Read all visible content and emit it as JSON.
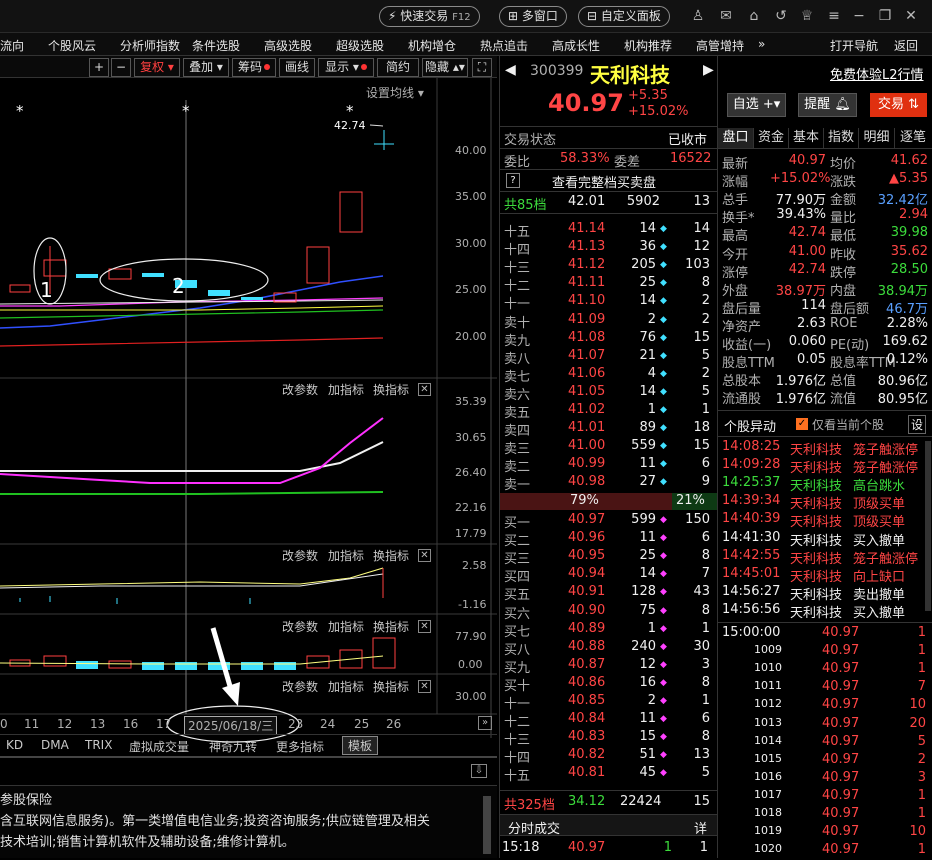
{
  "topbar": {
    "quick_trade": "快速交易",
    "quick_trade_key": "F12",
    "multi_window": "多窗口",
    "custom_panel": "自定义面板"
  },
  "menu": [
    "流向",
    "个股风云",
    "分析师指数",
    "条件选股",
    "高级选股",
    "超级选股",
    "机构增仓",
    "热点追击",
    "高成长性",
    "机构推荐",
    "高管增持",
    "»",
    "打开导航",
    "返回"
  ],
  "chart_toolbar": {
    "plus": "+",
    "minus": "−",
    "fuquan": "复权",
    "overlay": "叠加",
    "chips": "筹码",
    "draw": "画线",
    "display": "显示",
    "brief": "简约",
    "hide": "隐藏",
    "settings_ma": "设置均线"
  },
  "kline": {
    "price_ticks": [
      "40.00",
      "35.00",
      "30.00",
      "25.00",
      "20.00"
    ],
    "high_label": "42.74",
    "annotation_1": "1",
    "annotation_2": "2",
    "star": "*"
  },
  "indicator_panels": [
    {
      "change": "改参数",
      "add": "加指标",
      "swap": "换指标",
      "ticks": [
        "35.39",
        "30.65",
        "26.40",
        "22.16",
        "17.79"
      ]
    },
    {
      "change": "改参数",
      "add": "加指标",
      "swap": "换指标",
      "ticks": [
        "2.58",
        "-1.16"
      ]
    },
    {
      "change": "改参数",
      "add": "加指标",
      "swap": "换指标",
      "ticks": [
        "77.90",
        "0.00"
      ]
    },
    {
      "change": "改参数",
      "add": "加指标",
      "swap": "换指标",
      "ticks": [
        "30.00"
      ]
    }
  ],
  "date_axis": [
    "0",
    "11",
    "12",
    "13",
    "16",
    "17",
    "2025/06/18/三",
    "23",
    "24",
    "25",
    "26"
  ],
  "indicator_tabs": [
    "KD",
    "DMA",
    "TRIX",
    "虚拟成交量",
    "神奇九转",
    "更多指标",
    "模板"
  ],
  "company_text": {
    "line1": "参股保险",
    "line2": "含互联网信息服务)。第一类增值电信业务;投资咨询服务;供应链管理及相关",
    "line3": "技术培训;销售计算机软件及辅助设备;维修计算机。"
  },
  "stock": {
    "code": "300399",
    "name": "天利科技",
    "price": "40.97",
    "change": "+5.35",
    "change_pct": "+15.02%",
    "free_l2": "免费体验L2行情",
    "btn_watch": "自选",
    "btn_alert": "提醒",
    "btn_trade": "交易"
  },
  "orderbook": {
    "status_label": "交易状态",
    "status_value": "已收市",
    "weibi_label": "委比",
    "weibi_value": "58.33%",
    "weicha_label": "委差",
    "weicha_value": "16522",
    "full_book": "查看完整档买卖盘",
    "sell_total_label": "共85档",
    "sell_total_price": "42.01",
    "sell_total_vol": "5902",
    "sell_total_cnt": "13",
    "sells": [
      {
        "l": "十五",
        "p": "41.14",
        "v": "14",
        "c": "14"
      },
      {
        "l": "十四",
        "p": "41.13",
        "v": "36",
        "c": "12"
      },
      {
        "l": "十三",
        "p": "41.12",
        "v": "205",
        "c": "103"
      },
      {
        "l": "十二",
        "p": "41.11",
        "v": "25",
        "c": "8"
      },
      {
        "l": "十一",
        "p": "41.10",
        "v": "14",
        "c": "2"
      },
      {
        "l": "卖十",
        "p": "41.09",
        "v": "2",
        "c": "2"
      },
      {
        "l": "卖九",
        "p": "41.08",
        "v": "76",
        "c": "15"
      },
      {
        "l": "卖八",
        "p": "41.07",
        "v": "21",
        "c": "5"
      },
      {
        "l": "卖七",
        "p": "41.06",
        "v": "4",
        "c": "2"
      },
      {
        "l": "卖六",
        "p": "41.05",
        "v": "14",
        "c": "5"
      },
      {
        "l": "卖五",
        "p": "41.02",
        "v": "1",
        "c": "1"
      },
      {
        "l": "卖四",
        "p": "41.01",
        "v": "89",
        "c": "18"
      },
      {
        "l": "卖三",
        "p": "41.00",
        "v": "559",
        "c": "15"
      },
      {
        "l": "卖二",
        "p": "40.99",
        "v": "11",
        "c": "6"
      },
      {
        "l": "卖一",
        "p": "40.98",
        "v": "27",
        "c": "9"
      }
    ],
    "ratio_left": "79%",
    "ratio_right": "21%",
    "ratio_fraction": 0.79,
    "buys": [
      {
        "l": "买一",
        "p": "40.97",
        "v": "599",
        "c": "150"
      },
      {
        "l": "买二",
        "p": "40.96",
        "v": "11",
        "c": "6"
      },
      {
        "l": "买三",
        "p": "40.95",
        "v": "25",
        "c": "8"
      },
      {
        "l": "买四",
        "p": "40.94",
        "v": "14",
        "c": "7"
      },
      {
        "l": "买五",
        "p": "40.91",
        "v": "128",
        "c": "43"
      },
      {
        "l": "买六",
        "p": "40.90",
        "v": "75",
        "c": "8"
      },
      {
        "l": "买七",
        "p": "40.89",
        "v": "1",
        "c": "1"
      },
      {
        "l": "买八",
        "p": "40.88",
        "v": "240",
        "c": "30"
      },
      {
        "l": "买九",
        "p": "40.87",
        "v": "12",
        "c": "3"
      },
      {
        "l": "买十",
        "p": "40.86",
        "v": "16",
        "c": "8"
      },
      {
        "l": "十一",
        "p": "40.85",
        "v": "2",
        "c": "1"
      },
      {
        "l": "十二",
        "p": "40.84",
        "v": "11",
        "c": "6"
      },
      {
        "l": "十三",
        "p": "40.83",
        "v": "15",
        "c": "8"
      },
      {
        "l": "十四",
        "p": "40.82",
        "v": "51",
        "c": "13"
      },
      {
        "l": "十五",
        "p": "40.81",
        "v": "45",
        "c": "5"
      }
    ],
    "buy_total_label": "共325档",
    "buy_total_price": "34.12",
    "buy_total_vol": "22424",
    "buy_total_cnt": "15",
    "ticks_label": "分时成交",
    "ticks_detail": "详",
    "last_tick_time": "15:18",
    "last_tick_price": "40.97",
    "last_tick_vol": "1",
    "last_tick_cnt": "1"
  },
  "quote_tabs": [
    "盘口",
    "资金",
    "基本",
    "指数",
    "明细",
    "逐笔"
  ],
  "quote": [
    {
      "a": "最新",
      "av": "40.97",
      "b": "均价",
      "bv": "41.62"
    },
    {
      "a": "涨幅",
      "av": "+15.02%",
      "b": "涨跌",
      "bv": "▲5.35"
    },
    {
      "a": "总手",
      "av": "77.90万",
      "b": "金额",
      "bv": "32.42亿"
    },
    {
      "a": "换手*",
      "av": "39.43%",
      "b": "量比",
      "bv": "2.94"
    },
    {
      "a": "最高",
      "av": "42.74",
      "b": "最低",
      "bv": "39.98"
    },
    {
      "a": "今开",
      "av": "41.00",
      "b": "昨收",
      "bv": "35.62"
    },
    {
      "a": "涨停",
      "av": "42.74",
      "b": "跌停",
      "bv": "28.50"
    },
    {
      "a": "外盘",
      "av": "38.97万",
      "b": "内盘",
      "bv": "38.94万"
    },
    {
      "a": "盘后量",
      "av": "114",
      "b": "盘后额",
      "bv": "46.7万"
    },
    {
      "a": "净资产",
      "av": "2.63",
      "b": "ROE",
      "bv": "2.28%"
    },
    {
      "a": "收益(一)",
      "av": "0.060",
      "b": "PE(动)",
      "bv": "169.62"
    },
    {
      "a": "股息TTM",
      "av": "0.05",
      "b": "股息率TTM",
      "bv": "0.12%"
    },
    {
      "a": "总股本",
      "av": "1.976亿",
      "b": "总值",
      "bv": "80.96亿"
    },
    {
      "a": "流通股",
      "av": "1.976亿",
      "b": "流值",
      "bv": "80.95亿"
    }
  ],
  "movement": {
    "title": "个股异动",
    "only_current": "仅看当前个股",
    "settings": "设",
    "items": [
      {
        "t": "14:08:25",
        "n": "天利科技",
        "e": "笼子触涨停",
        "c": "red"
      },
      {
        "t": "14:09:28",
        "n": "天利科技",
        "e": "笼子触涨停",
        "c": "red"
      },
      {
        "t": "14:25:37",
        "n": "天利科技",
        "e": "高台跳水",
        "c": "green"
      },
      {
        "t": "14:39:34",
        "n": "天利科技",
        "e": "顶级买单",
        "c": "red"
      },
      {
        "t": "14:40:39",
        "n": "天利科技",
        "e": "顶级买单",
        "c": "red"
      },
      {
        "t": "14:41:30",
        "n": "天利科技",
        "e": "买入撤单",
        "c": "white"
      },
      {
        "t": "14:42:55",
        "n": "天利科技",
        "e": "笼子触涨停",
        "c": "red"
      },
      {
        "t": "14:45:01",
        "n": "天利科技",
        "e": "向上缺口",
        "c": "red"
      },
      {
        "t": "14:56:27",
        "n": "天利科技",
        "e": "卖出撤单",
        "c": "white"
      },
      {
        "t": "14:56:56",
        "n": "天利科技",
        "e": "买入撤单",
        "c": "white"
      }
    ]
  },
  "trades": [
    {
      "t": "15:00:00",
      "p": "40.97",
      "v": "1"
    },
    {
      "t": "1009",
      "p": "40.97",
      "v": "1"
    },
    {
      "t": "1010",
      "p": "40.97",
      "v": "1"
    },
    {
      "t": "1011",
      "p": "40.97",
      "v": "7"
    },
    {
      "t": "1012",
      "p": "40.97",
      "v": "10"
    },
    {
      "t": "1013",
      "p": "40.97",
      "v": "20"
    },
    {
      "t": "1014",
      "p": "40.97",
      "v": "5"
    },
    {
      "t": "1015",
      "p": "40.97",
      "v": "2"
    },
    {
      "t": "1016",
      "p": "40.97",
      "v": "3"
    },
    {
      "t": "1017",
      "p": "40.97",
      "v": "1"
    },
    {
      "t": "1018",
      "p": "40.97",
      "v": "1"
    },
    {
      "t": "1019",
      "p": "40.97",
      "v": "10"
    },
    {
      "t": "1020",
      "p": "40.97",
      "v": "1"
    }
  ]
}
